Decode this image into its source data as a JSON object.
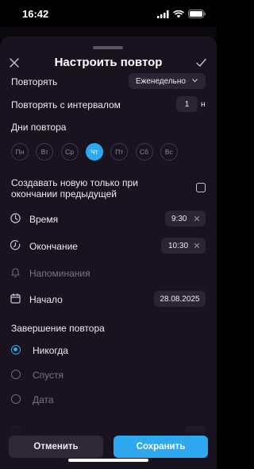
{
  "status": {
    "time": "16:42"
  },
  "header": {
    "title": "Настроить повтор"
  },
  "repeat": {
    "label": "Повторять",
    "value": "Еженедельно"
  },
  "interval": {
    "label": "Повторять с интервалом",
    "value": "1",
    "unit": "н"
  },
  "days": {
    "label": "Дни повтора",
    "items": [
      "Пн",
      "Вт",
      "Ср",
      "Чт",
      "Пт",
      "Сб",
      "Вс"
    ],
    "selected": "Чт"
  },
  "create_after": {
    "label_line1": "Создавать новую только при",
    "label_line2": "окончании предыдущей",
    "checked": false
  },
  "time": {
    "label": "Время",
    "value": "9:30"
  },
  "end": {
    "label": "Окончание",
    "value": "10:30"
  },
  "reminders": {
    "label": "Напоминания"
  },
  "start": {
    "label": "Начало",
    "value": "28.08.2025"
  },
  "completion": {
    "label": "Завершение повтора",
    "options": [
      "Никогда",
      "Спустя",
      "Дата"
    ],
    "selected": "Никогда"
  },
  "buttons": {
    "cancel": "Отменить",
    "save": "Сохранить"
  },
  "colors": {
    "accent": "#2ea8ee",
    "sheet_bg": "#19121f",
    "field_bg": "#2c2434"
  }
}
